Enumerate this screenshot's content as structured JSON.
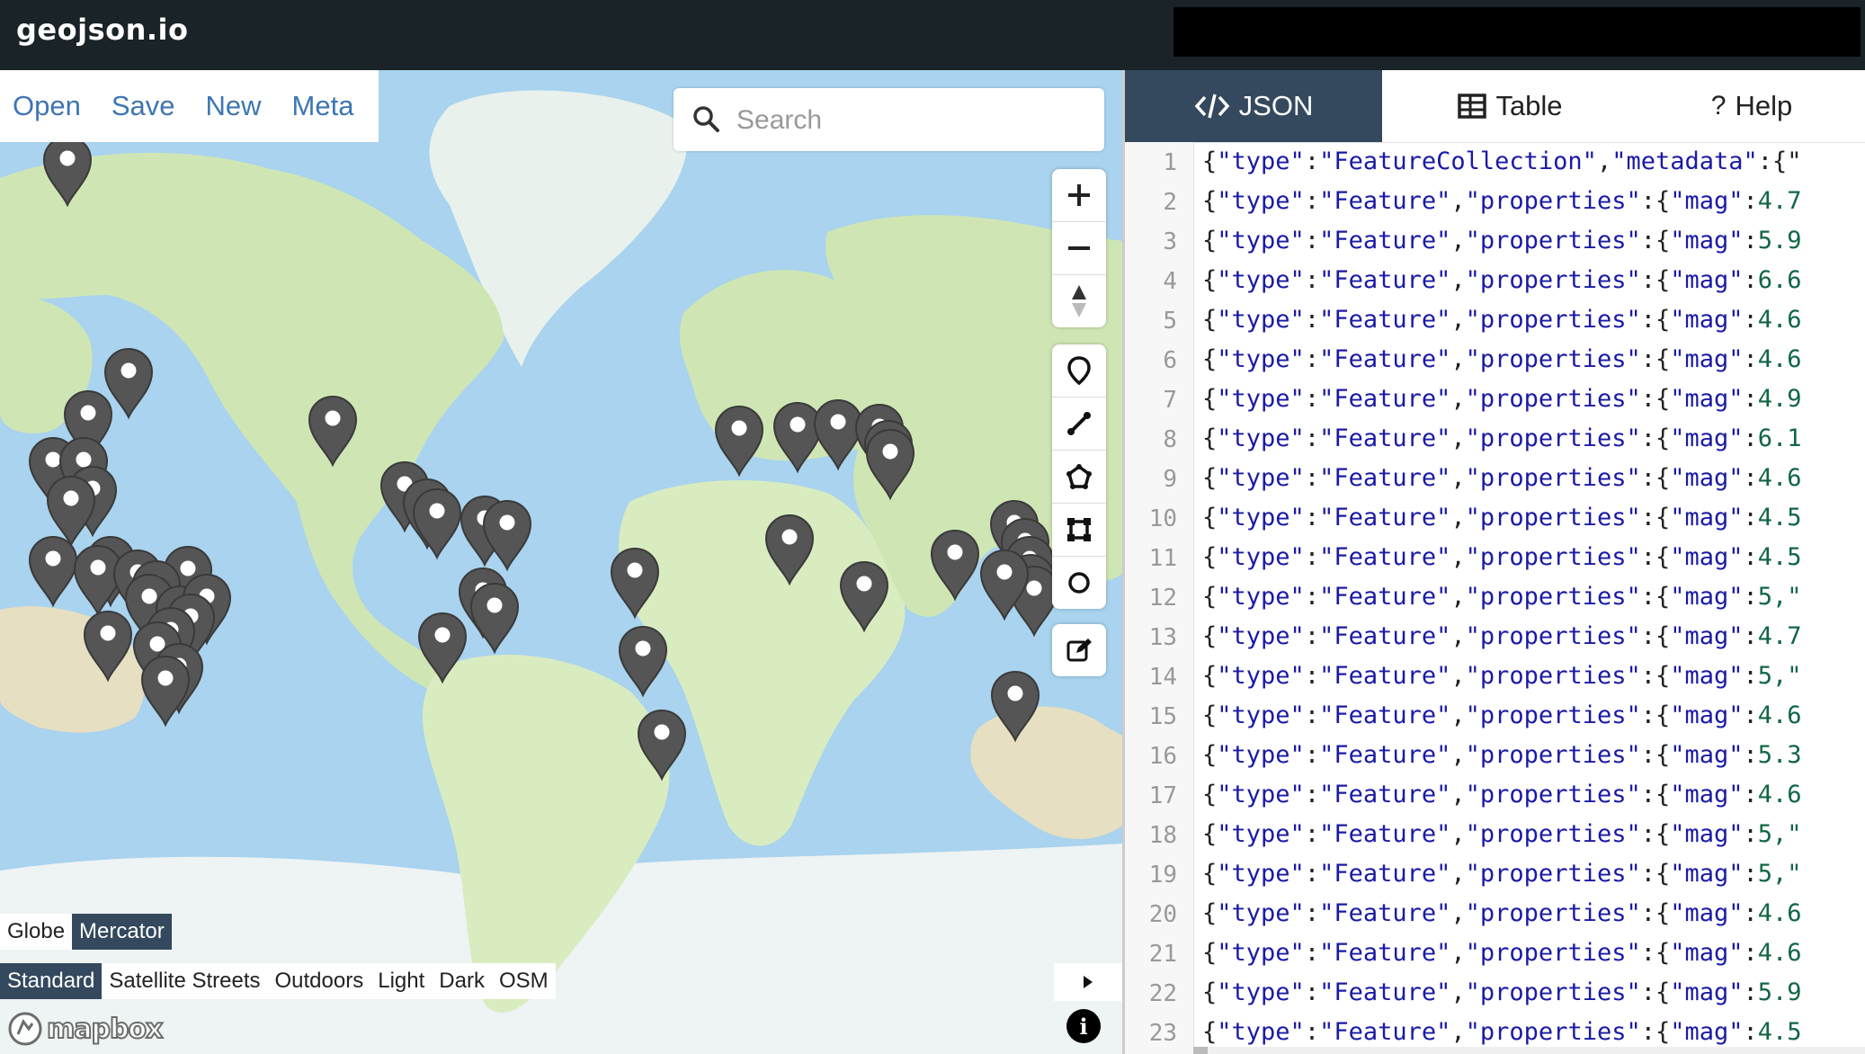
{
  "app": {
    "brand": "geojson.io"
  },
  "file_menu": {
    "items": [
      "Open",
      "Save",
      "New",
      "Meta"
    ]
  },
  "search": {
    "placeholder": "Search",
    "value": ""
  },
  "map_controls": {
    "zoom": [
      "zoom-in",
      "zoom-out",
      "compass"
    ],
    "draw_tools": [
      "draw-point",
      "draw-line",
      "draw-polygon",
      "draw-rectangle",
      "draw-circle"
    ],
    "edit": "edit"
  },
  "projection": {
    "options": [
      "Globe",
      "Mercator"
    ],
    "selected": "Mercator"
  },
  "map_styles": {
    "options": [
      "Standard",
      "Satellite Streets",
      "Outdoors",
      "Light",
      "Dark",
      "OSM"
    ],
    "selected": "Standard"
  },
  "attribution": {
    "logo": "mapbox",
    "info_icon": "i"
  },
  "colors": {
    "header": "#192328",
    "active_tab": "#34495e",
    "link": "#3d76b3",
    "water": "#a9d3ee",
    "land": "#d9ecc0",
    "marker": "#555555"
  },
  "panel": {
    "tabs": [
      {
        "label": "JSON",
        "icon": "code-icon",
        "active": true
      },
      {
        "label": "Table",
        "icon": "table-icon",
        "active": false
      },
      {
        "label": "Help",
        "icon": "question-icon",
        "active": false
      }
    ],
    "editor": {
      "lines": [
        {
          "n": "1",
          "type": "FeatureCollection",
          "key": "metadata",
          "tail": ":{\""
        },
        {
          "n": "2",
          "mag": "4.7"
        },
        {
          "n": "3",
          "mag": "5.9"
        },
        {
          "n": "4",
          "mag": "6.6"
        },
        {
          "n": "5",
          "mag": "4.6"
        },
        {
          "n": "6",
          "mag": "4.6"
        },
        {
          "n": "7",
          "mag": "4.9"
        },
        {
          "n": "8",
          "mag": "6.1"
        },
        {
          "n": "9",
          "mag": "4.6"
        },
        {
          "n": "10",
          "mag": "4.5"
        },
        {
          "n": "11",
          "mag": "4.5"
        },
        {
          "n": "12",
          "mag": "5,\""
        },
        {
          "n": "13",
          "mag": "4.7"
        },
        {
          "n": "14",
          "mag": "5,\""
        },
        {
          "n": "15",
          "mag": "4.6"
        },
        {
          "n": "16",
          "mag": "5.3"
        },
        {
          "n": "17",
          "mag": "4.6"
        },
        {
          "n": "18",
          "mag": "5,\""
        },
        {
          "n": "19",
          "mag": "5,\""
        },
        {
          "n": "20",
          "mag": "4.6"
        },
        {
          "n": "21",
          "mag": "4.6"
        },
        {
          "n": "22",
          "mag": "5.9"
        },
        {
          "n": "23",
          "mag": "4.5"
        }
      ]
    }
  }
}
